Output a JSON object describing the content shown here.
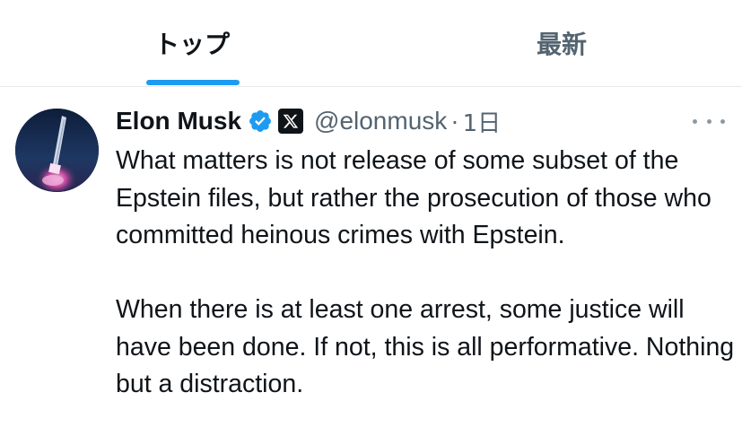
{
  "tabs": {
    "top_label": "トップ",
    "latest_label": "最新",
    "active": "top",
    "accent_color": "#1d9bf0"
  },
  "tweet": {
    "avatar_icon": "rocket-launch-avatar",
    "display_name": "Elon Musk",
    "verified_icon": "verified-badge-icon",
    "verified_color": "#1d9bf0",
    "affiliation_icon": "x-logo-icon",
    "handle": "@elonmusk",
    "separator": "·",
    "time": "1日",
    "more_icon": "more-options-icon",
    "paragraphs": [
      "What matters is not release of some subset of the Epstein files, but rather the prosecution of those who committed heinous crimes with Epstein.",
      "When there is at least one arrest, some justice will have been done. If not, this is all performative. Nothing but a distraction."
    ]
  }
}
